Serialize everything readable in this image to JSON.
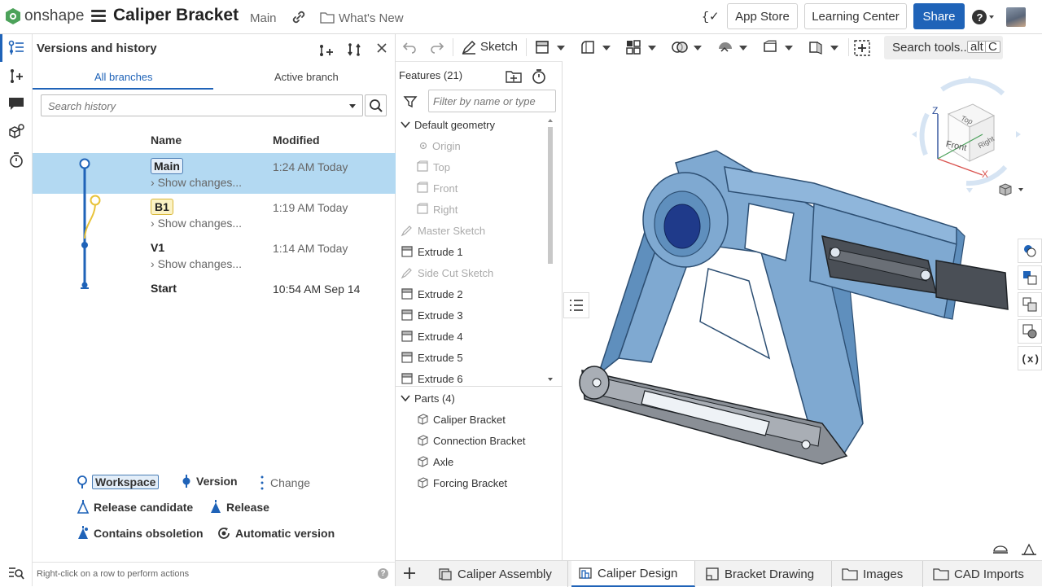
{
  "header": {
    "brand": "onshape",
    "doc_title": "Caliper Bracket",
    "workspace": "Main",
    "whats_new": "What's New",
    "app_store": "App Store",
    "learning_center": "Learning Center",
    "share": "Share"
  },
  "versions_panel": {
    "title": "Versions and history",
    "tabs": [
      "All branches",
      "Active branch"
    ],
    "search_placeholder": "Search history",
    "col_name": "Name",
    "col_modified": "Modified",
    "rows": [
      {
        "name": "Main",
        "changes": "Show changes...",
        "modified": "1:24 AM Today"
      },
      {
        "name": "B1",
        "changes": "Show changes...",
        "modified": "1:19 AM Today"
      },
      {
        "name": "V1",
        "changes": "Show changes...",
        "modified": "1:14 AM Today"
      },
      {
        "name": "Start",
        "changes": "",
        "modified": "10:54 AM Sep 14"
      }
    ],
    "legend": {
      "workspace": "Workspace",
      "version": "Version",
      "change": "Change",
      "release_candidate": "Release candidate",
      "release": "Release",
      "contains_obsoletion": "Contains obsoletion",
      "automatic_version": "Automatic version"
    },
    "footer_hint": "Right-click on a row to perform actions",
    "help": "?"
  },
  "toolbar": {
    "sketch": "Sketch",
    "search_tools": "Search tools...",
    "shortcut_alt": "alt",
    "shortcut_key": "C"
  },
  "features": {
    "header": "Features (21)",
    "filter_placeholder": "Filter by name or type",
    "default_group": "Default geometry",
    "default_items": [
      "Origin",
      "Top",
      "Front",
      "Right"
    ],
    "items": [
      "Master Sketch",
      "Extrude 1",
      "Side Cut Sketch",
      "Extrude 2",
      "Extrude 3",
      "Extrude 4",
      "Extrude 5",
      "Extrude 6"
    ],
    "parts_header": "Parts (4)",
    "parts": [
      "Caliper Bracket",
      "Connection Bracket",
      "Axle",
      "Forcing Bracket"
    ]
  },
  "view_cube": {
    "top": "Top",
    "front": "Front",
    "right": "Right",
    "axis_x": "X",
    "axis_z": "Z"
  },
  "bottom_tabs": [
    "Caliper Assembly",
    "Caliper Design",
    "Bracket Drawing",
    "Images",
    "CAD Imports"
  ],
  "colors": {
    "accent": "#1f63b8",
    "selection": "#b3d9f2",
    "part_blue": "#7fa9d1",
    "branch_yellow": "#e8c33a"
  }
}
